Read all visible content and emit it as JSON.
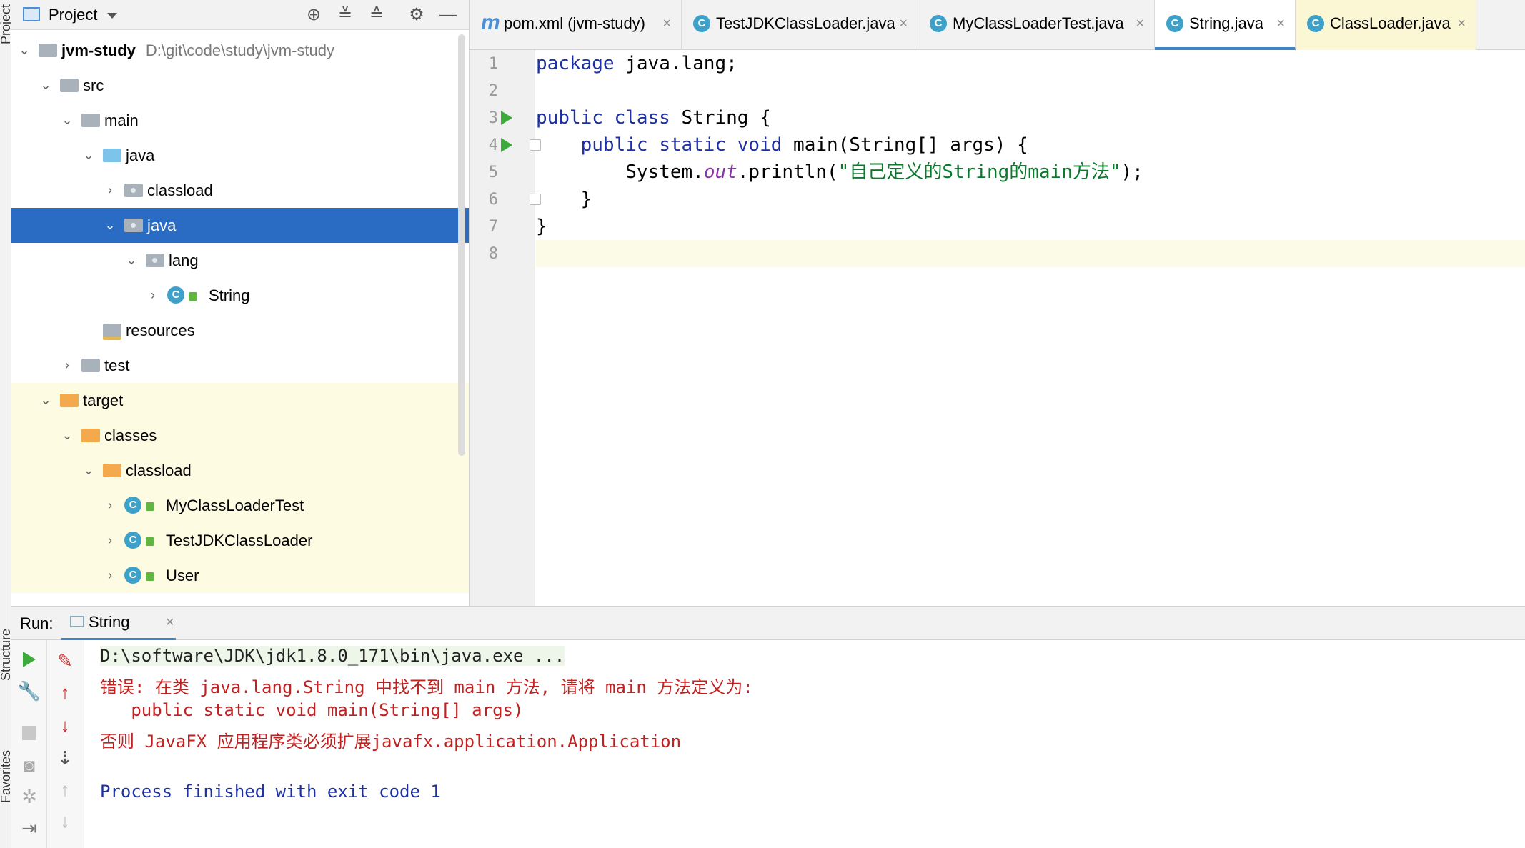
{
  "sidebar_strip": {
    "project_label": "Project",
    "structure_label": "Structure",
    "favorites_label": "Favorites"
  },
  "project_panel": {
    "title": "Project",
    "tree": [
      {
        "label": "jvm-study",
        "path": "D:\\git\\code\\study\\jvm-study"
      },
      {
        "label": "src"
      },
      {
        "label": "main"
      },
      {
        "label": "java"
      },
      {
        "label": "classload"
      },
      {
        "label": "java"
      },
      {
        "label": "lang"
      },
      {
        "label": "String"
      },
      {
        "label": "resources"
      },
      {
        "label": "test"
      },
      {
        "label": "target"
      },
      {
        "label": "classes"
      },
      {
        "label": "classload"
      },
      {
        "label": "MyClassLoaderTest"
      },
      {
        "label": "TestJDKClassLoader"
      },
      {
        "label": "User"
      }
    ]
  },
  "tabs": [
    {
      "label": "pom.xml (jvm-study)",
      "close": "×"
    },
    {
      "label": "TestJDKClassLoader.java",
      "close": "×"
    },
    {
      "label": "MyClassLoaderTest.java",
      "close": "×"
    },
    {
      "label": "String.java",
      "close": "×"
    },
    {
      "label": "ClassLoader.java",
      "close": "×"
    }
  ],
  "editor": {
    "line_numbers": [
      "1",
      "2",
      "3",
      "4",
      "5",
      "6",
      "7",
      "8"
    ],
    "code": {
      "l1_kw": "package",
      "l1_rest": " java.lang;",
      "l3_kw": "public class",
      "l3_rest": " String {",
      "l4_indent": "    ",
      "l4_kw": "public static void",
      "l4_rest": " main(String[] args) {",
      "l5_indent": "        System.",
      "l5_field": "out",
      "l5_mid": ".println(",
      "l5_str": "\"自己定义的String的main方法\"",
      "l5_end": ");",
      "l6": "    }",
      "l7": "}"
    }
  },
  "run_panel": {
    "label": "Run:",
    "tab_label": "String",
    "tab_close": "×",
    "console": {
      "cmd": "D:\\software\\JDK\\jdk1.8.0_171\\bin\\java.exe ...",
      "err1": "错误: 在类 java.lang.String 中找不到 main 方法, 请将 main 方法定义为:",
      "err2": "   public static void main(String[] args)",
      "err3": "否则 JavaFX 应用程序类必须扩展javafx.application.Application",
      "finish": "Process finished with exit code 1"
    }
  },
  "colors": {
    "selection": "#2a6cc4",
    "keyword": "#1c2fa3",
    "string": "#0b7a2d",
    "error": "#c32020",
    "tab_underline": "#4083c9"
  },
  "icons": [
    "project-icon",
    "locate-icon",
    "expand-all-icon",
    "collapse-all-icon",
    "gear-icon",
    "minimize-icon",
    "run-icon",
    "wrench-icon",
    "stop-icon",
    "camera-icon",
    "bug-icon",
    "exit-icon",
    "rerun-icon",
    "up-arrow-icon",
    "down-arrow-icon",
    "sort-icon",
    "scroll-up-icon",
    "scroll-down-icon"
  ]
}
